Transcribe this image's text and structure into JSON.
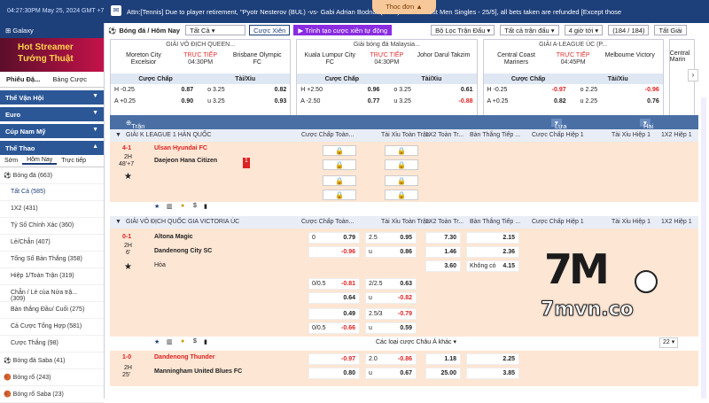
{
  "topbar": {
    "time": "04:27:30PM May 25, 2024 GMT +7",
    "ticker": "Attn:[Tennis] Due to player retirement, \"Pyotr Nesterov (BUL) -vs- Gabi Adrian Bodnar (ROU)\" - Bucharest Men Singles - 25/5], all bets taken are refunded [Except those",
    "pill": "Thoc đơn"
  },
  "sidebar": {
    "galaxy": "Galaxy",
    "banner": "Hot Streamer Tướng Thuật",
    "tab1": "Phiếu Đặ...",
    "tab2": "Bảng Cược",
    "sections": [
      {
        "label": "Thể Vận Hội"
      },
      {
        "label": "Euro"
      },
      {
        "label": "Cúp Nam Mỹ"
      },
      {
        "label": "Thể Thao"
      }
    ],
    "sport_tabs": [
      "Sớm",
      "Hôm Nay",
      "Trực tiếp"
    ],
    "items": [
      {
        "label": "Bóng đá (663)"
      },
      {
        "label": "Tất Cả (585)"
      },
      {
        "label": "1X2 (431)"
      },
      {
        "label": "Tỷ Số Chính Xác (360)"
      },
      {
        "label": "Lẻ/Chẵn (407)"
      },
      {
        "label": "Tổng Số Bàn Thắng (358)"
      },
      {
        "label": "Hiệp 1/Toàn Trận (319)"
      },
      {
        "label": "Chẵn / Lẻ của Nửa trậ... (309)"
      },
      {
        "label": "Bàn thắng Đầu/ Cuối (275)"
      },
      {
        "label": "Cả Cược Tổng Hợp (581)"
      },
      {
        "label": "Cược Thắng (98)"
      },
      {
        "label": "Bóng đá Saba (41)"
      },
      {
        "label": "Bóng rổ (243)"
      },
      {
        "label": "Bóng rổ Saba (23)"
      }
    ]
  },
  "filter": {
    "sport": "Bóng đá / Hôm Nay",
    "all": "Tất Cả",
    "cuoc_xien": "Cược Xiên",
    "tao_xien": "Trình tạo cược xiên tự động",
    "loc": "Bộ Lọc Trận Đấu",
    "tatca_tran": "Tất cả trận đấu",
    "gio": "4 giờ tới",
    "count": "(184 / 184)",
    "giai": "Tất Giải"
  },
  "cards": [
    {
      "league": "GIẢI VÔ ĐỊCH QUEEN...",
      "home": "Moreton City Excelsior",
      "away": "Brisbane Olympic FC",
      "status": "TRỰC TIẾP",
      "time": "04:30PM",
      "h_ah": "H -0.25",
      "h_ah_v": "0.87",
      "h_ou": "o 3.25",
      "h_ou_v": "0.82",
      "a_ah": "A +0.25",
      "a_ah_v": "0.90",
      "a_ou": "u 3.25",
      "a_ou_v": "0.93",
      "h_ou_red": false,
      "a_ou_red": false
    },
    {
      "league": "Giải bóng đá Malaysia...",
      "home": "Kuala Lumpur City FC",
      "away": "Johor Darul Takzim",
      "status": "TRỰC TIẾP",
      "time": "04:30PM",
      "h_ah": "H +2.50",
      "h_ah_v": "0.96",
      "h_ou": "o 3.25",
      "h_ou_v": "0.61",
      "a_ah": "A -2.50",
      "a_ah_v": "0.77",
      "a_ou": "u 3.25",
      "a_ou_v": "-0.88",
      "h_ou_red": false,
      "a_ou_red": true
    },
    {
      "league": "GIẢI A-LEAGUE ÚC (P...",
      "home": "Central Coast Mariners",
      "away": "Melbourne Victory",
      "status": "TRỰC TIẾP",
      "time": "04:45PM",
      "h_ah": "H -0.25",
      "h_ah_v": "-0.97",
      "h_ou": "o 2.25",
      "h_ou_v": "-0.96",
      "a_ah": "A +0.25",
      "a_ah_v": "0.82",
      "a_ou": "u 2.25",
      "a_ou_v": "0.76",
      "h_ou_red": true,
      "a_ou_red": false
    }
  ],
  "card_headers": {
    "ah": "Cược Chấp",
    "ou": "Tài/Xỉu"
  },
  "partial_card": {
    "l1": "Central",
    "l2": "Marin"
  },
  "table": {
    "title": "Trận Đấu",
    "sort": "Lựa chọn bình thường",
    "view": "Hai Dòng",
    "cols": [
      "Cược Chấp Toàn...",
      "Tài Xỉu Toàn Trận",
      "1X2 Toàn Tr...",
      "Bàn Thắng Tiếp ...",
      "Cược Chấp Hiệp 1",
      "Tài Xỉu Hiệp 1",
      "1X2 Hiệp 1"
    ],
    "league1": "GIẢI K LEAGUE 1 HÀN QUỐC",
    "league2": "GIẢI VÔ ĐỊCH QUỐC GIA VICTORIA ÚC",
    "m1": {
      "score": "4-1",
      "period": "2H",
      "minute": "48'+7",
      "home": "Ulsan Hyundai FC",
      "away": "Daejeon Hana Citizen",
      "card": "1"
    },
    "m2": {
      "score": "0-1",
      "period": "2H",
      "minute": "6'",
      "home": "Altona Magic",
      "away": "Dandenong City SC",
      "draw": "Hòa",
      "r1": {
        "hcap": "0",
        "hv": "0.79",
        "ou": "2.5",
        "ouv": "0.95",
        "x": "7.30",
        "next": "2.15"
      },
      "r2": {
        "hv": "-0.96",
        "ou": "u",
        "ouv": "0.86",
        "x": "1.46",
        "next": "2.36"
      },
      "r3": {
        "x": "3.60",
        "next_l": "Không có",
        "next": "4.15"
      },
      "s1": {
        "hcap": "0/0.5",
        "hv": "-0.81",
        "ou": "2/2.5",
        "ouv": "0.63"
      },
      "s2": {
        "hv": "0.64",
        "ou": "u",
        "ouv": "-0.82"
      },
      "s3": {
        "hv": "0.49",
        "ou": "2.5/3",
        "ouv": "-0.79"
      },
      "s4": {
        "hcap": "0/0.5",
        "hv": "-0.66",
        "ou": "u",
        "ouv": "0.59"
      },
      "more": "Các loại cược Châu Á khác",
      "page": "22"
    },
    "m3": {
      "score": "1-0",
      "period": "2H",
      "minute": "25'",
      "home": "Dandenong Thunder",
      "away": "Manningham United Blues FC",
      "hv1": "-0.97",
      "ou1": "2.0",
      "ouv1": "-0.86",
      "x1": "1.18",
      "n1": "2.25",
      "hv2": "0.80",
      "ou2": "u",
      "ouv2": "0.67",
      "x2": "25.00",
      "n2": "3.85"
    }
  },
  "watermark": {
    "logo": "7M",
    "url": "7mvn.co"
  }
}
